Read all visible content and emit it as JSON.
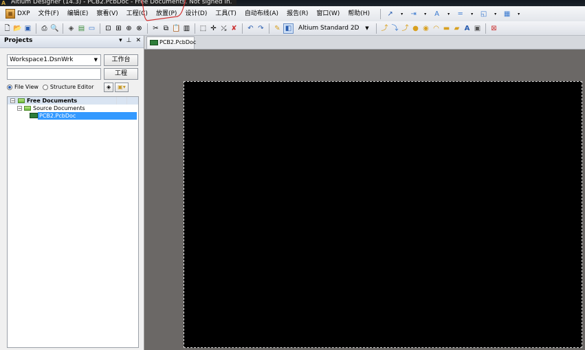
{
  "window": {
    "title": "Altium Designer (14.3) - PCB2.PcbDoc - Free Documents. Not signed in."
  },
  "menu": {
    "items": [
      "DXP",
      "文件(F)",
      "编辑(E)",
      "察看(V)",
      "工程(C)",
      "放置(P)",
      "设计(D)",
      "工具(T)",
      "自动布线(A)",
      "报告(R)",
      "窗口(W)",
      "帮助(H)"
    ]
  },
  "toolbar": {
    "view_mode": "Altium Standard 2D"
  },
  "projects_panel": {
    "title": "Projects",
    "workspace_combo": "Workspace1.DsnWrk",
    "workspace_button": "工作台",
    "project_button": "工程",
    "radio_file_view": "File View",
    "radio_structure_editor": "Structure Editor",
    "tree": {
      "free_documents": "Free Documents",
      "source_documents": "Source Documents",
      "selected_file": "PCB2.PcbDoc"
    }
  },
  "document": {
    "tab_label": "PCB2.PcbDoc"
  },
  "colors": {
    "board": "#000000",
    "workspace": "#6b6866",
    "selection": "#3399ff",
    "annotation": "#d33030"
  }
}
